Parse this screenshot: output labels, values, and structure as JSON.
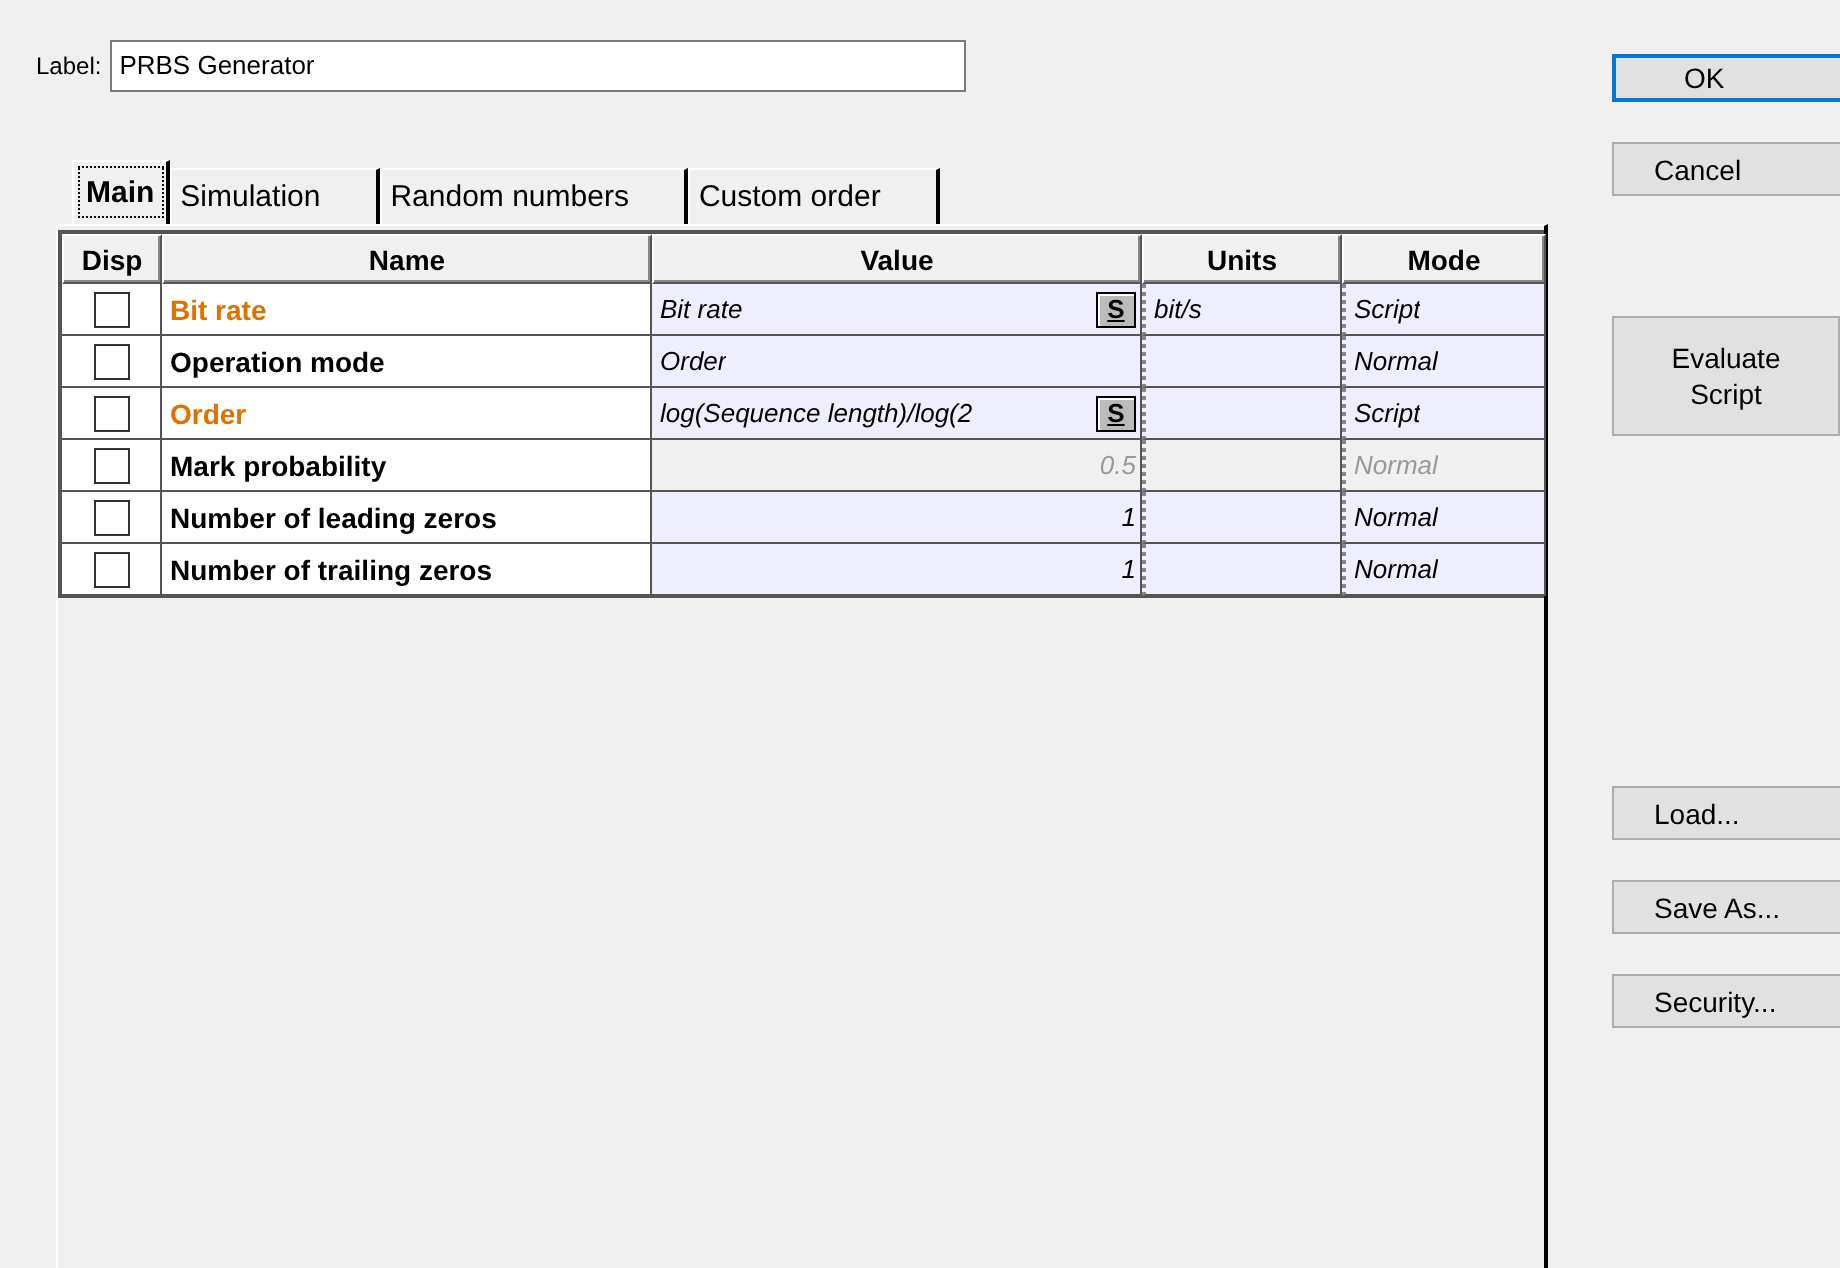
{
  "label_field": {
    "label": "Label:",
    "value": "PRBS Generator"
  },
  "tabs": [
    {
      "label": "Main",
      "selected": true
    },
    {
      "label": "Simulation",
      "selected": false
    },
    {
      "label": "Random numbers",
      "selected": false
    },
    {
      "label": "Custom order",
      "selected": false
    }
  ],
  "table": {
    "columns": [
      "Disp",
      "Name",
      "Value",
      "Units",
      "Mode"
    ],
    "rows": [
      {
        "checked": false,
        "name": "Bit rate",
        "highlighted": true,
        "value": "Bit rate",
        "kind": "text",
        "script_button": "S",
        "units": "bit/s",
        "mode": "Script",
        "disabled": false
      },
      {
        "checked": false,
        "name": "Operation mode",
        "highlighted": false,
        "value": "Order",
        "kind": "text",
        "mode": "Normal",
        "disabled": false
      },
      {
        "checked": false,
        "name": "Order",
        "highlighted": true,
        "value": "log(Sequence length)/log(2",
        "kind": "text",
        "script_button": "S",
        "mode": "Script",
        "disabled": false
      },
      {
        "checked": false,
        "name": "Mark probability",
        "highlighted": false,
        "value": "0.5",
        "kind": "number",
        "mode": "Normal",
        "disabled": true
      },
      {
        "checked": false,
        "name": "Number of leading zeros",
        "highlighted": false,
        "value": "1",
        "kind": "number",
        "mode": "Normal",
        "disabled": false
      },
      {
        "checked": false,
        "name": "Number of trailing zeros",
        "highlighted": false,
        "value": "1",
        "kind": "number",
        "mode": "Normal",
        "disabled": false
      }
    ]
  },
  "button_groups": [
    [
      {
        "label": "OK",
        "kind": "default"
      },
      {
        "label": "Cancel",
        "kind": "normal"
      }
    ],
    [
      {
        "label": "Evaluate Script",
        "kind": "tall"
      }
    ],
    [
      {
        "label": "Load...",
        "kind": "normal"
      },
      {
        "label": "Save As...",
        "kind": "normal"
      },
      {
        "label": "Security...",
        "kind": "normal"
      }
    ]
  ]
}
